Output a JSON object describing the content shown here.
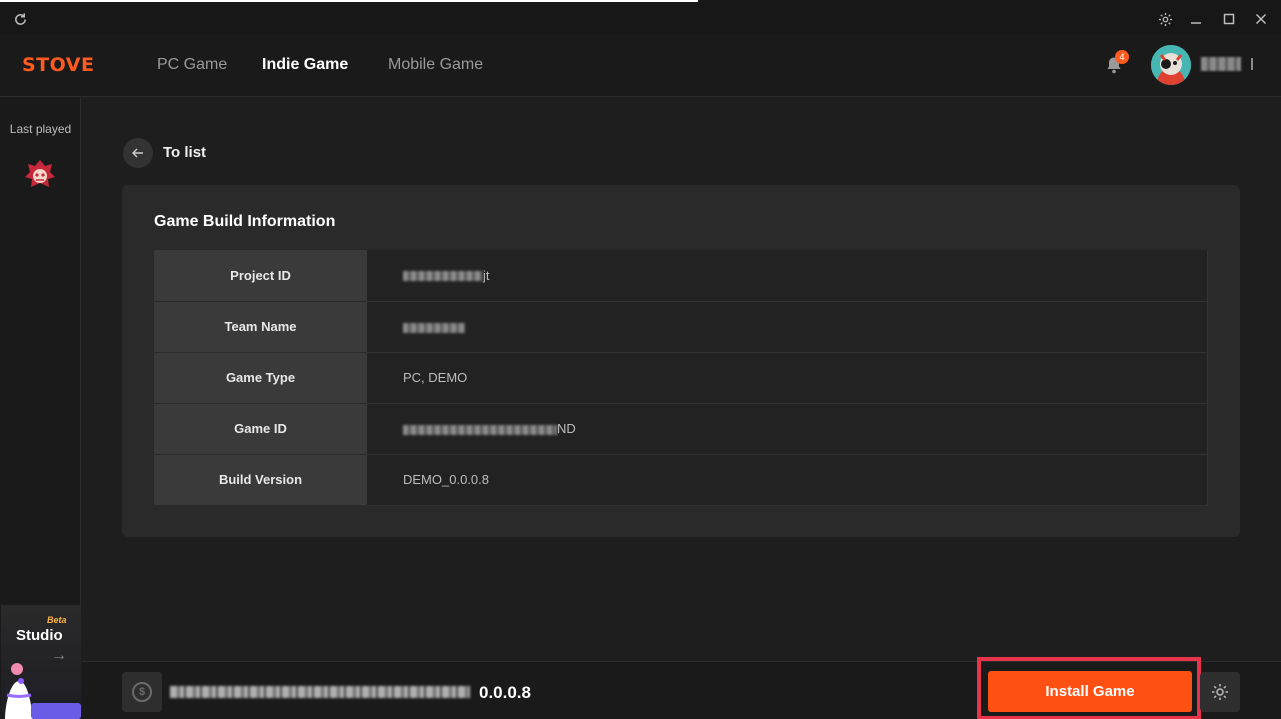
{
  "titlebar": {
    "icons": [
      "refresh-icon",
      "settings-icon",
      "minimize-icon",
      "maximize-icon",
      "close-icon"
    ]
  },
  "header": {
    "logo": "STOVE",
    "nav": [
      {
        "label": "PC Game",
        "active": false
      },
      {
        "label": "Indie Game",
        "active": true
      },
      {
        "label": "Mobile Game",
        "active": false
      }
    ],
    "notification_count": "4"
  },
  "sidebar": {
    "last_played_label": "Last played",
    "studio_beta": "Beta",
    "studio_label": "Studio"
  },
  "content": {
    "back_label": "To list",
    "card_title": "Game Build Information",
    "rows": [
      {
        "key": "Project ID",
        "value_suffix": "jt"
      },
      {
        "key": "Team Name",
        "value_suffix": ""
      },
      {
        "key": "Game Type",
        "value": "PC, DEMO"
      },
      {
        "key": "Game ID",
        "value_suffix": "ND"
      },
      {
        "key": "Build Version",
        "value": "DEMO_0.0.0.8"
      }
    ]
  },
  "bottombar": {
    "build_version": "0.0.0.8",
    "install_label": "Install Game"
  },
  "colors": {
    "accent": "#ff5014",
    "highlight_frame": "#e8344a",
    "background": "#1e1e1e"
  }
}
